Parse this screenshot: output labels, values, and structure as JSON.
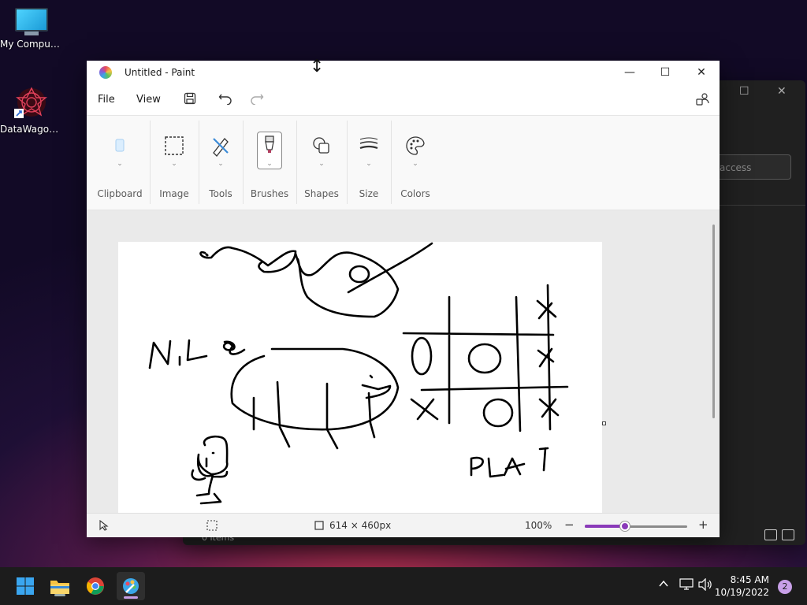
{
  "desktop": {
    "icons": [
      {
        "label": "My Computer"
      },
      {
        "label": "DataWagon..."
      }
    ]
  },
  "background_window": {
    "search_placeholder": "access",
    "status": "0 items"
  },
  "paint": {
    "title": "Untitled - Paint",
    "menu": {
      "file": "File",
      "view": "View"
    },
    "ribbon": {
      "groups": [
        {
          "label": "Clipboard"
        },
        {
          "label": "Image"
        },
        {
          "label": "Tools"
        },
        {
          "label": "Brushes"
        },
        {
          "label": "Shapes"
        },
        {
          "label": "Size"
        },
        {
          "label": "Colors"
        }
      ]
    },
    "status": {
      "canvas_size": "614 × 460px",
      "zoom": "100%",
      "zoom_minus": "−",
      "zoom_plus": "+"
    },
    "drawing_text": [
      "NiLe",
      "PLAY"
    ]
  },
  "taskbar": {
    "time": "8:45 AM",
    "date": "10/19/2022",
    "notification_count": "2"
  },
  "colors": {
    "accent": "#8a3ab9",
    "taskbar": "#1c1c1c"
  }
}
